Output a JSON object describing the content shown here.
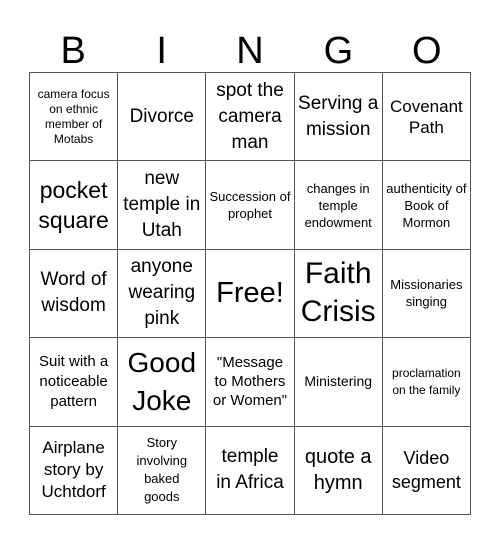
{
  "header": [
    "B",
    "I",
    "N",
    "G",
    "O"
  ],
  "cells": [
    [
      "camera focus on ethnic member of Motabs",
      "Divorce",
      "spot the camera man",
      "Serving a mission",
      "Covenant Path"
    ],
    [
      "pocket square",
      "new temple in Utah",
      "Succession of prophet",
      "changes in temple endowment",
      "authenticity of Book of Mormon"
    ],
    [
      "Word of wisdom",
      "anyone wearing pink",
      "Free!",
      "Faith Crisis",
      "Missionaries singing"
    ],
    [
      "Suit with a noticeable pattern",
      "Good Joke",
      "\"Message to Mothers or Women\"",
      "Ministering",
      "proclamation on the family"
    ],
    [
      "Airplane story by Uchtdorf",
      "Story involving baked goods",
      "temple in Africa",
      "quote a hymn",
      "Video segment"
    ]
  ]
}
